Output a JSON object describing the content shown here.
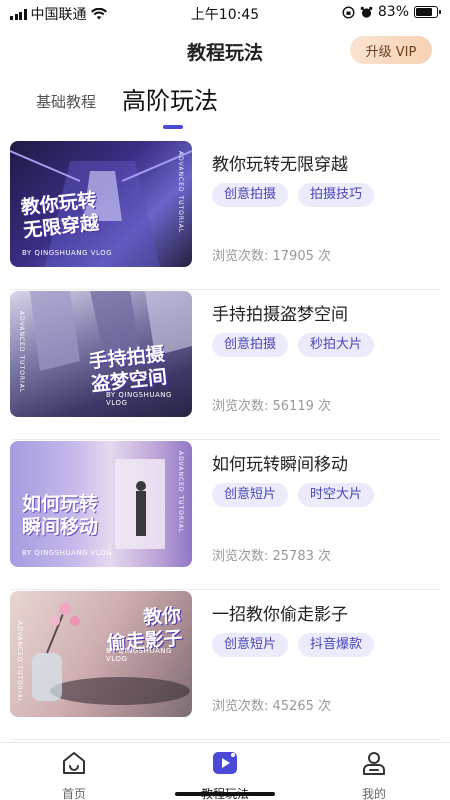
{
  "status_bar": {
    "carrier": "中国联通",
    "time": "上午10:45",
    "battery": "83%",
    "battery_level": 0.83
  },
  "header": {
    "title": "教程玩法",
    "vip_button": "升级 VIP"
  },
  "tabs": [
    {
      "label": "基础教程",
      "active": false
    },
    {
      "label": "高阶玩法",
      "active": true
    }
  ],
  "tutorials": [
    {
      "title": "教你玩转无限穿越",
      "tags": [
        "创意拍摄",
        "拍摄技巧"
      ],
      "views": "浏览次数: 17905 次",
      "thumb_title": "教你玩转\n无限穿越",
      "thumb_sub": "BY QINGSHUANG VLOG",
      "thumb_side": "ADVANCED TUTORIAL"
    },
    {
      "title": "手持拍摄盗梦空间",
      "tags": [
        "创意拍摄",
        "秒拍大片"
      ],
      "views": "浏览次数: 56119 次",
      "thumb_title": "手持拍摄\n盗梦空间",
      "thumb_sub": "BY QINGSHUANG VLOG",
      "thumb_side": "ADVANCED TUTORIAL"
    },
    {
      "title": "如何玩转瞬间移动",
      "tags": [
        "创意短片",
        "时空大片"
      ],
      "views": "浏览次数: 25783 次",
      "thumb_title": "如何玩转\n瞬间移动",
      "thumb_sub": "BY QINGSHUANG VLOG",
      "thumb_side": "ADVANCED TUTORIAL"
    },
    {
      "title": "一招教你偷走影子",
      "tags": [
        "创意短片",
        "抖音爆款"
      ],
      "views": "浏览次数: 45265 次",
      "thumb_title": "教你\n偷走影子",
      "thumb_sub": "BY QINGSHUANG VLOG",
      "thumb_side": "ADVANCED TUTORIAL"
    }
  ],
  "tabbar": {
    "home": "首页",
    "tutorials": "教程玩法",
    "mine": "我的"
  },
  "colors": {
    "accent": "#4a4ad6",
    "tag_bg": "#ecebfb",
    "tag_text": "#4a47b8",
    "vip_bg": "#f6d2b4"
  }
}
